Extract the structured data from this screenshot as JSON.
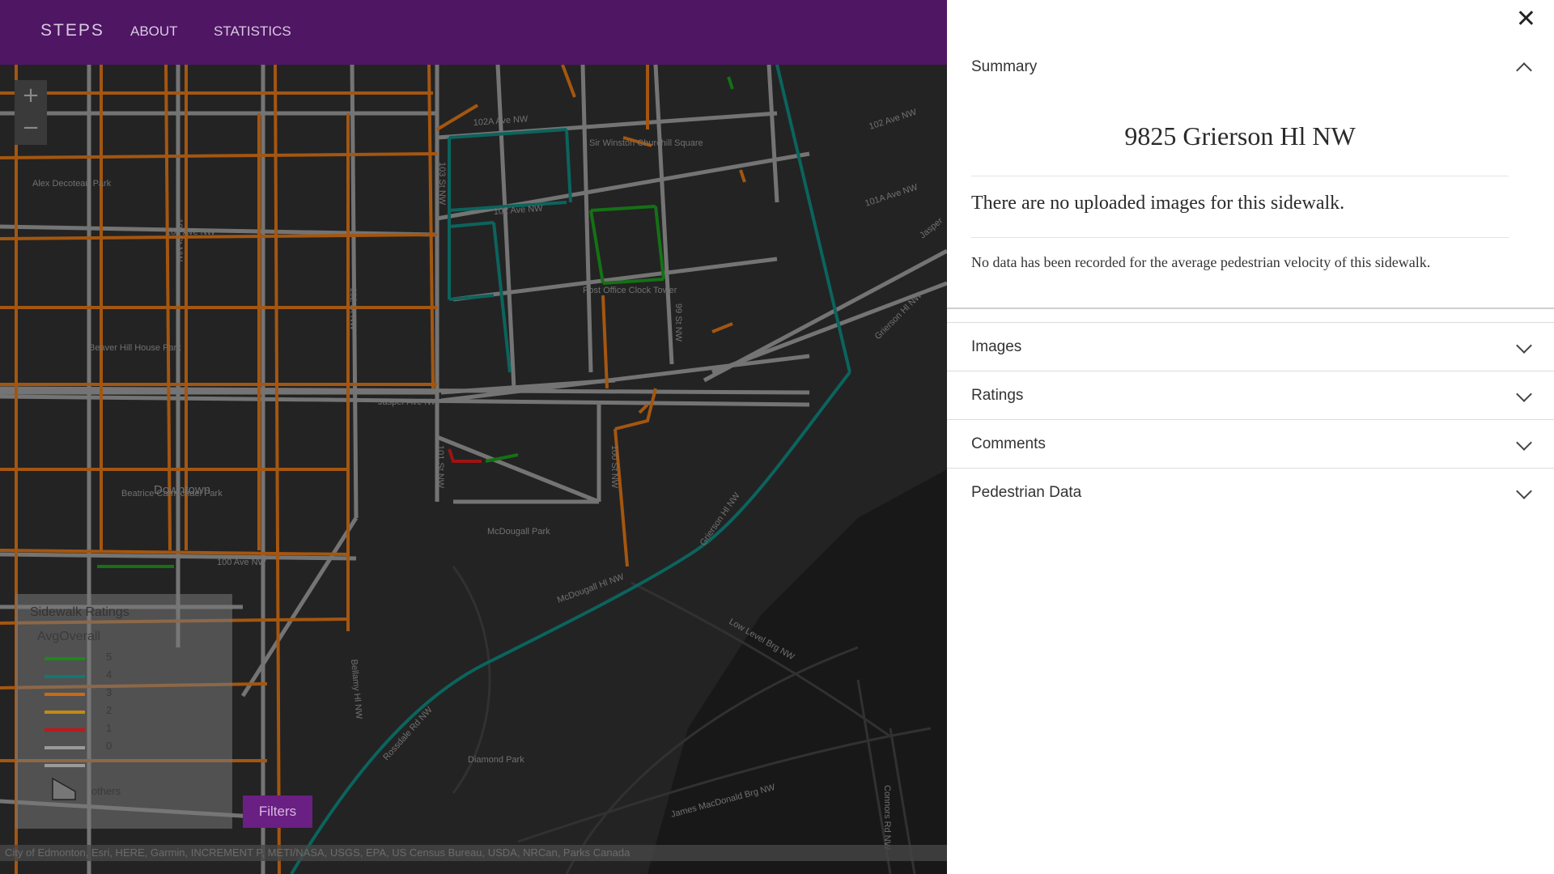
{
  "header": {
    "brand": "STEPS",
    "nav": [
      "ABOUT",
      "STATISTICS"
    ],
    "color": "#4f1664"
  },
  "map": {
    "zoom_in": "+",
    "zoom_out": "−",
    "labels": {
      "ave_102a": "102A Ave NW",
      "ave_102a_right": "102 Ave NW",
      "ave_101a": "101A Ave NW",
      "ave_102_left": "102 Ave NW",
      "ave_102_mid": "102 Ave NW",
      "ave_100": "100 Ave NW",
      "st_104": "104 St NW",
      "st_103": "103 St NW",
      "st_102": "102 St NW",
      "st_101": "101 St NW",
      "st_100": "100 St NW",
      "st_99": "99 St NW",
      "jasper": "Jasper Ave NW",
      "jasper_right": "Jasper",
      "grierson": "Grierson Hl NW",
      "mcdougall_hl": "McDougall Hl NW",
      "low_level": "Low Level Brg NW",
      "rossdale": "Rossdale Rd NW",
      "bellamy": "Bellamy Hl NW",
      "james_mac": "James MacDonald Brg NW",
      "connors": "Connors Rd NW",
      "downtown": "Downtown",
      "alex_decoteau": "Alex Decoteau Park",
      "beaver_hill": "Beaver Hill House Park",
      "beatrice": "Beatrice Carmichael Park",
      "winston": "Sir Winston Churchill Square",
      "post_office": "Post Office Clock Tower",
      "mcdougall_park": "McDougall Park",
      "diamond_park": "Diamond Park"
    },
    "attribution": "City of Edmonton, Esri, HERE, Garmin, INCREMENT P, METI/NASA, USGS, EPA, US Census Bureau, USDA, NRCan, Parks Canada"
  },
  "legend": {
    "title": "Sidewalk Ratings",
    "subtitle": "AvgOverall",
    "items": [
      {
        "label": "5",
        "color": "#1a8a1a"
      },
      {
        "label": "4",
        "color": "#0e7a72"
      },
      {
        "label": "3",
        "color": "#c86a14"
      },
      {
        "label": "2",
        "color": "#c38a14"
      },
      {
        "label": "1",
        "color": "#c01818"
      },
      {
        "label": "0",
        "color": "#9a9a9a"
      },
      {
        "label": "",
        "color": "#9a9a9a"
      }
    ],
    "others_label": "others"
  },
  "filters_button": "Filters",
  "panel": {
    "close_icon": "close-icon",
    "summary": {
      "title": "Summary",
      "address": "9825 Grierson Hl NW",
      "no_images": "There are no uploaded images for this sidewalk.",
      "no_velocity": "No data has been recorded for the average pedestrian velocity of this sidewalk."
    },
    "sections": [
      "Images",
      "Ratings",
      "Comments",
      "Pedestrian Data"
    ]
  }
}
